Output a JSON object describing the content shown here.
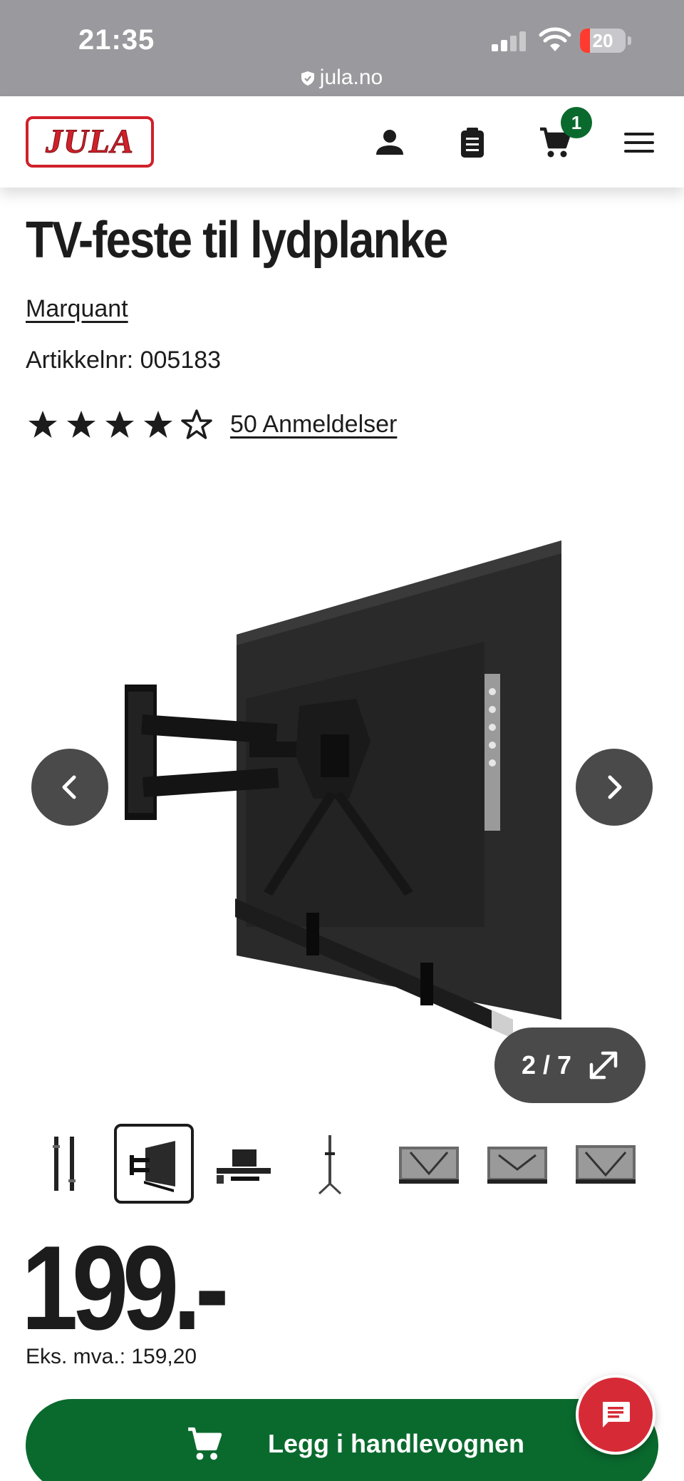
{
  "status_bar": {
    "time": "21:35",
    "battery": "20",
    "url": "jula.no"
  },
  "header": {
    "logo_text": "JULA",
    "cart_count": "1"
  },
  "product": {
    "title": "TV-feste til lydplanke",
    "brand": "Marquant",
    "article_number": "Artikkelnr: 005183",
    "rating": 4,
    "rating_max": 5,
    "reviews": "50 Anmeldelser"
  },
  "gallery": {
    "counter": "2 / 7",
    "thumbnail_count": 7,
    "active_index": 1
  },
  "price": {
    "value": "199.-",
    "ex_vat": "Eks. mva.: 159,20"
  },
  "actions": {
    "add_to_cart": "Legg i handlevognen"
  },
  "colors": {
    "brand_red": "#d0202a",
    "primary_green": "#0a6a2e",
    "chat_red": "#d62b36",
    "nav_gray": "#4a4a4a"
  },
  "icons": [
    "shield-icon",
    "user-icon",
    "clipboard-icon",
    "cart-icon",
    "menu-icon",
    "chevron-left-icon",
    "chevron-right-icon",
    "expand-icon",
    "chat-icon",
    "star-icon"
  ]
}
